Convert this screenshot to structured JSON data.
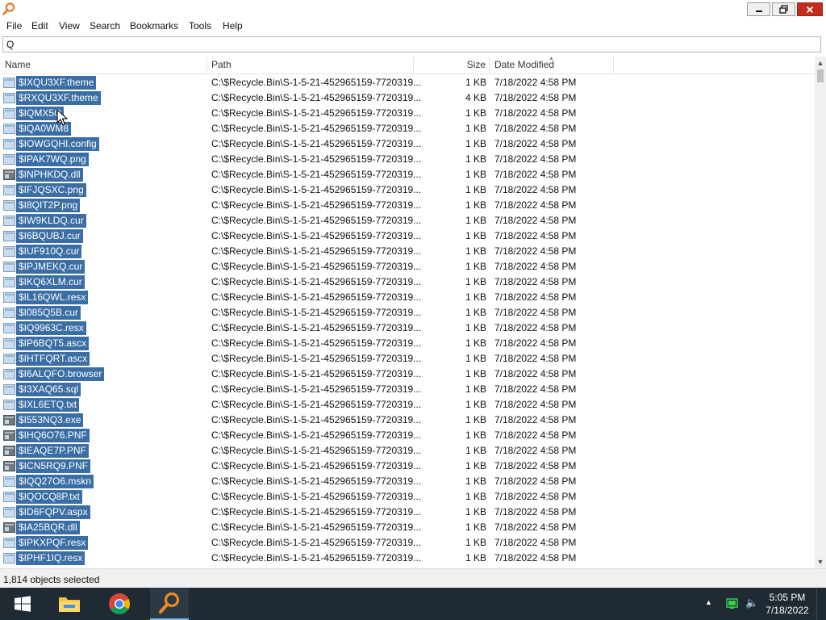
{
  "window": {
    "title": ""
  },
  "menu": [
    "File",
    "Edit",
    "View",
    "Search",
    "Bookmarks",
    "Tools",
    "Help"
  ],
  "search": {
    "value": "Q",
    "placeholder": ""
  },
  "columns": {
    "name": "Name",
    "path": "Path",
    "size": "Size",
    "date": "Date Modified"
  },
  "rows": [
    {
      "name": "$IXQU3XF.theme",
      "icon": "file",
      "path": "C:\\$Recycle.Bin\\S-1-5-21-452965159-7720319...",
      "size": "1 KB",
      "date": "7/18/2022 4:58 PM"
    },
    {
      "name": "$RXQU3XF.theme",
      "icon": "file",
      "path": "C:\\$Recycle.Bin\\S-1-5-21-452965159-7720319...",
      "size": "4 KB",
      "date": "7/18/2022 4:58 PM"
    },
    {
      "name": "$IQMX5Q",
      "icon": "file",
      "path": "C:\\$Recycle.Bin\\S-1-5-21-452965159-7720319...",
      "size": "1 KB",
      "date": "7/18/2022 4:58 PM"
    },
    {
      "name": "$IQA0WM8",
      "icon": "file",
      "path": "C:\\$Recycle.Bin\\S-1-5-21-452965159-7720319...",
      "size": "1 KB",
      "date": "7/18/2022 4:58 PM"
    },
    {
      "name": "$IOWGQHI.config",
      "icon": "file",
      "path": "C:\\$Recycle.Bin\\S-1-5-21-452965159-7720319...",
      "size": "1 KB",
      "date": "7/18/2022 4:58 PM"
    },
    {
      "name": "$IPAK7WQ.png",
      "icon": "file",
      "path": "C:\\$Recycle.Bin\\S-1-5-21-452965159-7720319...",
      "size": "1 KB",
      "date": "7/18/2022 4:58 PM"
    },
    {
      "name": "$INPHKDQ.dll",
      "icon": "dll",
      "path": "C:\\$Recycle.Bin\\S-1-5-21-452965159-7720319...",
      "size": "1 KB",
      "date": "7/18/2022 4:58 PM"
    },
    {
      "name": "$IFJQSXC.png",
      "icon": "file",
      "path": "C:\\$Recycle.Bin\\S-1-5-21-452965159-7720319...",
      "size": "1 KB",
      "date": "7/18/2022 4:58 PM"
    },
    {
      "name": "$I8QIT2P.png",
      "icon": "file",
      "path": "C:\\$Recycle.Bin\\S-1-5-21-452965159-7720319...",
      "size": "1 KB",
      "date": "7/18/2022 4:58 PM"
    },
    {
      "name": "$IW9KLDQ.cur",
      "icon": "file",
      "path": "C:\\$Recycle.Bin\\S-1-5-21-452965159-7720319...",
      "size": "1 KB",
      "date": "7/18/2022 4:58 PM"
    },
    {
      "name": "$I6BQUBJ.cur",
      "icon": "file",
      "path": "C:\\$Recycle.Bin\\S-1-5-21-452965159-7720319...",
      "size": "1 KB",
      "date": "7/18/2022 4:58 PM"
    },
    {
      "name": "$IUF910Q.cur",
      "icon": "file",
      "path": "C:\\$Recycle.Bin\\S-1-5-21-452965159-7720319...",
      "size": "1 KB",
      "date": "7/18/2022 4:58 PM"
    },
    {
      "name": "$IPJMEKQ.cur",
      "icon": "file",
      "path": "C:\\$Recycle.Bin\\S-1-5-21-452965159-7720319...",
      "size": "1 KB",
      "date": "7/18/2022 4:58 PM"
    },
    {
      "name": "$IKQ6XLM.cur",
      "icon": "file",
      "path": "C:\\$Recycle.Bin\\S-1-5-21-452965159-7720319...",
      "size": "1 KB",
      "date": "7/18/2022 4:58 PM"
    },
    {
      "name": "$IL16QWL.resx",
      "icon": "file",
      "path": "C:\\$Recycle.Bin\\S-1-5-21-452965159-7720319...",
      "size": "1 KB",
      "date": "7/18/2022 4:58 PM"
    },
    {
      "name": "$I085Q5B.cur",
      "icon": "file",
      "path": "C:\\$Recycle.Bin\\S-1-5-21-452965159-7720319...",
      "size": "1 KB",
      "date": "7/18/2022 4:58 PM"
    },
    {
      "name": "$IQ9963C.resx",
      "icon": "file",
      "path": "C:\\$Recycle.Bin\\S-1-5-21-452965159-7720319...",
      "size": "1 KB",
      "date": "7/18/2022 4:58 PM"
    },
    {
      "name": "$IP6BQT5.ascx",
      "icon": "file",
      "path": "C:\\$Recycle.Bin\\S-1-5-21-452965159-7720319...",
      "size": "1 KB",
      "date": "7/18/2022 4:58 PM"
    },
    {
      "name": "$IHTFQRT.ascx",
      "icon": "file",
      "path": "C:\\$Recycle.Bin\\S-1-5-21-452965159-7720319...",
      "size": "1 KB",
      "date": "7/18/2022 4:58 PM"
    },
    {
      "name": "$I6ALQFO.browser",
      "icon": "file",
      "path": "C:\\$Recycle.Bin\\S-1-5-21-452965159-7720319...",
      "size": "1 KB",
      "date": "7/18/2022 4:58 PM"
    },
    {
      "name": "$I3XAQ65.sql",
      "icon": "file",
      "path": "C:\\$Recycle.Bin\\S-1-5-21-452965159-7720319...",
      "size": "1 KB",
      "date": "7/18/2022 4:58 PM"
    },
    {
      "name": "$IXL6ETQ.txt",
      "icon": "file",
      "path": "C:\\$Recycle.Bin\\S-1-5-21-452965159-7720319...",
      "size": "1 KB",
      "date": "7/18/2022 4:58 PM"
    },
    {
      "name": "$I553NQ3.exe",
      "icon": "dll",
      "path": "C:\\$Recycle.Bin\\S-1-5-21-452965159-7720319...",
      "size": "1 KB",
      "date": "7/18/2022 4:58 PM"
    },
    {
      "name": "$IHQ6O76.PNF",
      "icon": "dll",
      "path": "C:\\$Recycle.Bin\\S-1-5-21-452965159-7720319...",
      "size": "1 KB",
      "date": "7/18/2022 4:58 PM"
    },
    {
      "name": "$IEAQE7P.PNF",
      "icon": "dll",
      "path": "C:\\$Recycle.Bin\\S-1-5-21-452965159-7720319...",
      "size": "1 KB",
      "date": "7/18/2022 4:58 PM"
    },
    {
      "name": "$ICN5RQ9.PNF",
      "icon": "dll",
      "path": "C:\\$Recycle.Bin\\S-1-5-21-452965159-7720319...",
      "size": "1 KB",
      "date": "7/18/2022 4:58 PM"
    },
    {
      "name": "$IQQ27O6.mskn",
      "icon": "file",
      "path": "C:\\$Recycle.Bin\\S-1-5-21-452965159-7720319...",
      "size": "1 KB",
      "date": "7/18/2022 4:58 PM"
    },
    {
      "name": "$IQOCQ8P.txt",
      "icon": "file",
      "path": "C:\\$Recycle.Bin\\S-1-5-21-452965159-7720319...",
      "size": "1 KB",
      "date": "7/18/2022 4:58 PM"
    },
    {
      "name": "$ID6FQPV.aspx",
      "icon": "file",
      "path": "C:\\$Recycle.Bin\\S-1-5-21-452965159-7720319...",
      "size": "1 KB",
      "date": "7/18/2022 4:58 PM"
    },
    {
      "name": "$IA25BQR.dll",
      "icon": "dll",
      "path": "C:\\$Recycle.Bin\\S-1-5-21-452965159-7720319...",
      "size": "1 KB",
      "date": "7/18/2022 4:58 PM"
    },
    {
      "name": "$IPKXPQF.resx",
      "icon": "file",
      "path": "C:\\$Recycle.Bin\\S-1-5-21-452965159-7720319...",
      "size": "1 KB",
      "date": "7/18/2022 4:58 PM"
    },
    {
      "name": "$IPHF1IQ.resx",
      "icon": "file",
      "path": "C:\\$Recycle.Bin\\S-1-5-21-452965159-7720319...",
      "size": "1 KB",
      "date": "7/18/2022 4:58 PM"
    }
  ],
  "status": {
    "text": "1,814 objects selected"
  },
  "taskbar": {
    "items": [
      "windows-start-icon",
      "file-explorer-icon",
      "chrome-icon",
      "everything-search-icon"
    ],
    "clock_time": "5:05 PM",
    "clock_date": "7/18/2022"
  },
  "colors": {
    "selection": "#3a6ea5",
    "taskbar": "#1f2a33",
    "close": "#c42b1c",
    "app_accent": "#e87722"
  }
}
